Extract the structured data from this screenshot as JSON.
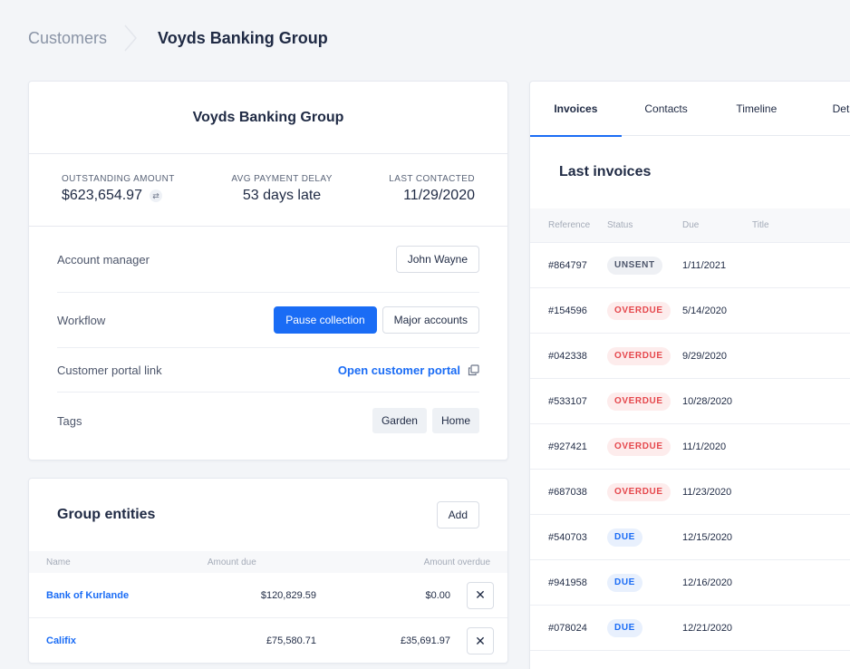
{
  "breadcrumb": {
    "parent": "Customers",
    "current": "Voyds Banking Group"
  },
  "summary": {
    "title": "Voyds Banking Group",
    "stats": [
      {
        "label": "Outstanding amount",
        "value": "$623,654.97"
      },
      {
        "label": "Avg payment delay",
        "value": "53 days late"
      },
      {
        "label": "Last contacted",
        "value": "11/29/2020"
      }
    ],
    "account_manager": {
      "label": "Account manager",
      "value": "John Wayne"
    },
    "workflow": {
      "label": "Workflow",
      "pause_label": "Pause collection",
      "workflow_label": "Major accounts"
    },
    "portal": {
      "label": "Customer portal link",
      "link_label": "Open customer portal"
    },
    "tags": {
      "label": "Tags",
      "items": [
        "Garden",
        "Home"
      ]
    }
  },
  "entities": {
    "title": "Group entities",
    "add_label": "Add",
    "columns": [
      "Name",
      "Amount due",
      "Amount overdue"
    ],
    "rows": [
      {
        "name": "Bank of Kurlande",
        "amount_due": "$120,829.59",
        "amount_overdue": "$0.00"
      },
      {
        "name": "Califix",
        "amount_due": "£75,580.71",
        "amount_overdue": "£35,691.97"
      }
    ]
  },
  "invoices": {
    "tabs": [
      "Invoices",
      "Contacts",
      "Timeline",
      "Deta"
    ],
    "title": "Last invoices",
    "columns": [
      "Reference",
      "Status",
      "Due",
      "Title"
    ],
    "rows": [
      {
        "ref": "#864797",
        "status": "UNSENT",
        "due": "1/11/2021"
      },
      {
        "ref": "#154596",
        "status": "OVERDUE",
        "due": "5/14/2020"
      },
      {
        "ref": "#042338",
        "status": "OVERDUE",
        "due": "9/29/2020"
      },
      {
        "ref": "#533107",
        "status": "OVERDUE",
        "due": "10/28/2020"
      },
      {
        "ref": "#927421",
        "status": "OVERDUE",
        "due": "11/1/2020"
      },
      {
        "ref": "#687038",
        "status": "OVERDUE",
        "due": "11/23/2020"
      },
      {
        "ref": "#540703",
        "status": "DUE",
        "due": "12/15/2020"
      },
      {
        "ref": "#941958",
        "status": "DUE",
        "due": "12/16/2020"
      },
      {
        "ref": "#078024",
        "status": "DUE",
        "due": "12/21/2020"
      }
    ]
  },
  "colors": {
    "accent": "#1a6cf5",
    "overdue": "#e5484d",
    "background": "#f3f5f8"
  }
}
